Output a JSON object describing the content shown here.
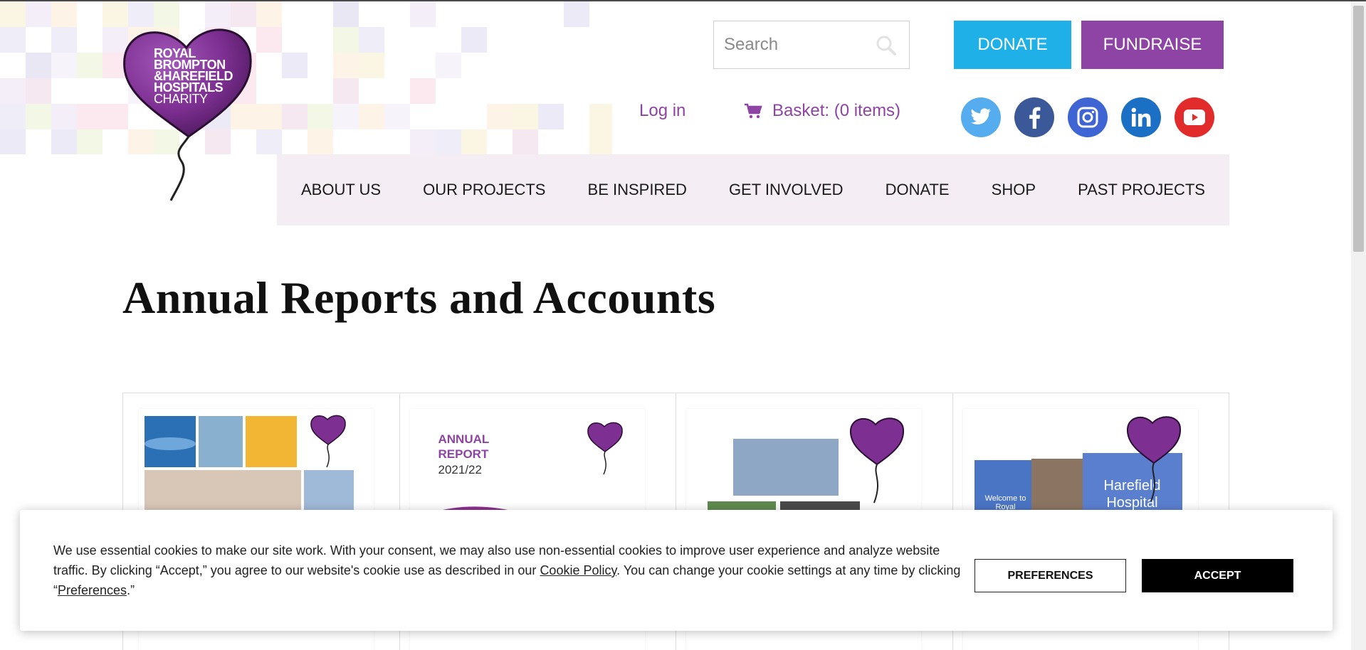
{
  "logo": {
    "line1": "ROYAL",
    "line2": "BROMPTON",
    "line3": "&HAREFIELD",
    "line4": "HOSPITALS",
    "line5": "CHARITY",
    "icon": "heart-balloon-logo"
  },
  "header": {
    "search_placeholder": "Search",
    "donate_label": "DONATE",
    "fundraise_label": "FUNDRAISE",
    "login_label": "Log in",
    "basket_label": "Basket: (0 items)",
    "social": [
      {
        "name": "twitter",
        "icon": "twitter-icon",
        "color": "#55acee"
      },
      {
        "name": "facebook",
        "icon": "facebook-icon",
        "color": "#3b5998"
      },
      {
        "name": "instagram",
        "icon": "instagram-icon",
        "color": "#3f65d4"
      },
      {
        "name": "linkedin",
        "icon": "linkedin-icon",
        "color": "#1b6fc4"
      },
      {
        "name": "youtube",
        "icon": "youtube-icon",
        "color": "#e22b2b"
      }
    ]
  },
  "nav": {
    "items": [
      {
        "label": "ABOUT US"
      },
      {
        "label": "OUR PROJECTS"
      },
      {
        "label": "BE INSPIRED"
      },
      {
        "label": "GET INVOLVED"
      },
      {
        "label": "DONATE"
      },
      {
        "label": "SHOP"
      },
      {
        "label": "PAST PROJECTS"
      }
    ]
  },
  "main": {
    "title": "Annual Reports and Accounts",
    "reports": [
      {
        "cover_heading": "",
        "cover_year": ""
      },
      {
        "cover_heading": "ANNUAL REPORT",
        "cover_year": "2021/22"
      },
      {
        "cover_heading": "",
        "cover_year": ""
      },
      {
        "cover_heading": "",
        "cover_year": "",
        "sign_text_1": "Welcome to Royal Brompton",
        "sign_text_2": "Harefield Hospital"
      }
    ]
  },
  "cookie": {
    "text_1": "We use essential cookies to make our site work. With your consent, we may also use non-essential cookies to improve user experience and analyze website traffic. By clicking “Accept,” you agree to our website's cookie use as described in our ",
    "policy_link": "Cookie Policy",
    "text_2": ". You can change your cookie settings at any time by clicking “",
    "preferences_link": "Preferences",
    "text_3": ".”",
    "preferences_button": "PREFERENCES",
    "accept_button": "ACCEPT"
  },
  "colors": {
    "brand_purple": "#8e44a4",
    "donate_blue": "#1eb0e6",
    "nav_background": "#f4eef4"
  }
}
